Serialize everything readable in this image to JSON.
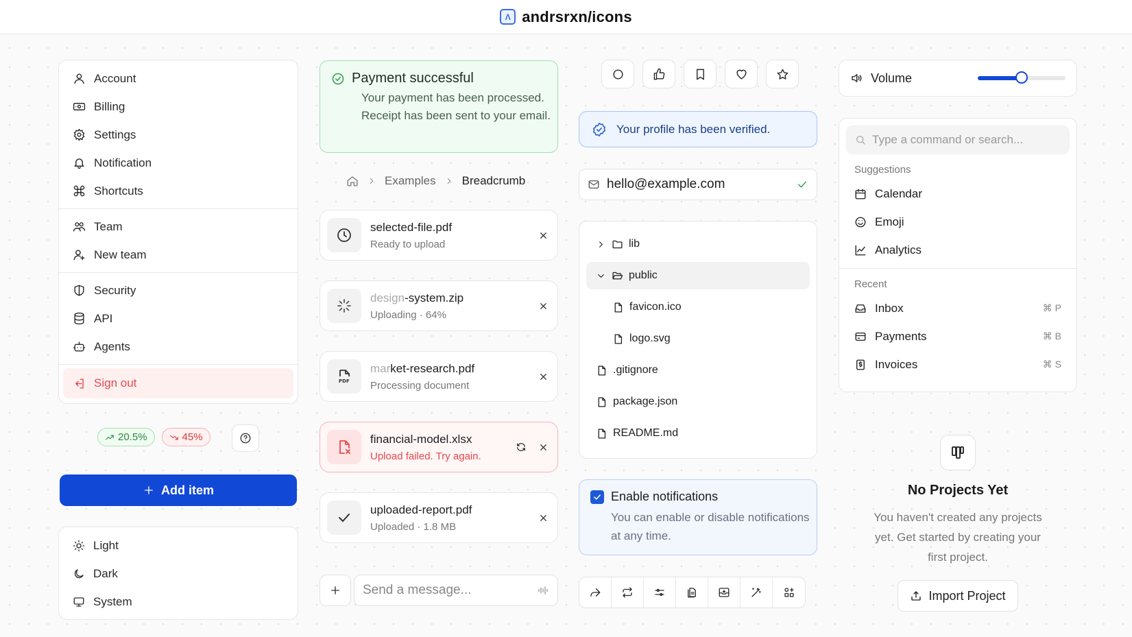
{
  "header": {
    "logo_glyph": "Λ",
    "title": "andrsrxn/icons"
  },
  "menu": {
    "group1": [
      {
        "label": "Account",
        "icon": "user-icon"
      },
      {
        "label": "Billing",
        "icon": "billing-icon"
      },
      {
        "label": "Settings",
        "icon": "gear-icon"
      },
      {
        "label": "Notification",
        "icon": "bell-icon"
      },
      {
        "label": "Shortcuts",
        "icon": "command-icon"
      }
    ],
    "group2": [
      {
        "label": "Team",
        "icon": "team-icon"
      },
      {
        "label": "New team",
        "icon": "user-plus-icon"
      }
    ],
    "group3": [
      {
        "label": "Security",
        "icon": "shield-icon"
      },
      {
        "label": "API",
        "icon": "database-icon"
      },
      {
        "label": "Agents",
        "icon": "bot-icon"
      }
    ],
    "signout": {
      "label": "Sign out",
      "icon": "logout-icon"
    }
  },
  "badges": {
    "up": "20.5%",
    "down": "45%"
  },
  "add_button": "Add item",
  "theme": [
    {
      "label": "Light",
      "icon": "sun-icon"
    },
    {
      "label": "Dark",
      "icon": "moon-icon"
    },
    {
      "label": "System",
      "icon": "monitor-icon"
    }
  ],
  "payment_alert": {
    "title": "Payment successful",
    "description": "Your payment has been processed. Receipt has been sent to your email."
  },
  "breadcrumb": {
    "items": [
      "Examples"
    ],
    "current": "Breadcrumb"
  },
  "files": [
    {
      "name_faded": "",
      "name": "selected-file.pdf",
      "status": "Ready to upload"
    },
    {
      "name_faded": "design",
      "name": "-system.zip",
      "status": "Uploading · 64%"
    },
    {
      "name_faded": "mar",
      "name": "ket-research.pdf",
      "status": "Processing document"
    },
    {
      "name_faded": "",
      "name": "financial-model.xlsx",
      "status": "Upload failed. Try again."
    },
    {
      "name_faded": "",
      "name": "uploaded-report.pdf",
      "status": "Uploaded · 1.8 MB"
    }
  ],
  "message_input": {
    "placeholder": "Send a message..."
  },
  "verified_alert": "Your profile has been verified.",
  "email_field": {
    "value": "hello@example.com"
  },
  "file_tree": {
    "folder_lib": "lib",
    "folder_public": "public",
    "public_children": [
      "favicon.ico",
      "logo.svg"
    ],
    "root_files": [
      ".gitignore",
      "package.json",
      "README.md"
    ]
  },
  "notifications": {
    "label": "Enable notifications",
    "description": "You can enable or disable notifications at any time.",
    "checked": true
  },
  "volume": {
    "label": "Volume",
    "level": 0.5
  },
  "command": {
    "placeholder": "Type a command or search...",
    "suggestions_title": "Suggestions",
    "suggestions": [
      {
        "label": "Calendar",
        "icon": "calendar-icon"
      },
      {
        "label": "Emoji",
        "icon": "smile-icon"
      },
      {
        "label": "Analytics",
        "icon": "chart-icon"
      }
    ],
    "recent_title": "Recent",
    "recent": [
      {
        "label": "Inbox",
        "shortcut": "⌘ P",
        "icon": "inbox-icon"
      },
      {
        "label": "Payments",
        "shortcut": "⌘ B",
        "icon": "card-icon"
      },
      {
        "label": "Invoices",
        "shortcut": "⌘ S",
        "icon": "invoice-icon"
      }
    ]
  },
  "empty_state": {
    "title": "No Projects Yet",
    "description": "You haven't created any projects yet. Get started by creating your first project.",
    "button": "Import Project"
  },
  "colors": {
    "accent": "#1148d6",
    "success": "#2e9e4b",
    "danger": "#e5484d",
    "info": "#2f63c9"
  }
}
